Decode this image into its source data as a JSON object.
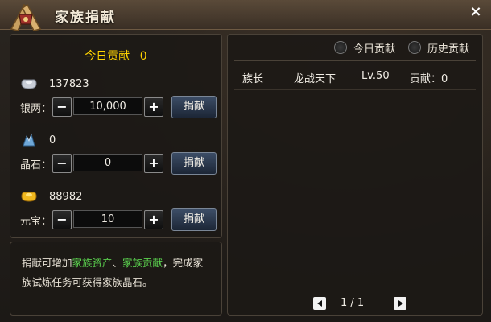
{
  "window": {
    "title": "家族捐献",
    "close_label": "×"
  },
  "donate": {
    "today_label": "今日贡献",
    "today_value": "0",
    "button_label": "捐献",
    "resources": [
      {
        "name": "银两",
        "amount": "137823",
        "quantity": "10,000",
        "icon": "silver-ingot-icon"
      },
      {
        "name": "晶石",
        "amount": "0",
        "quantity": "0",
        "icon": "crystal-icon"
      },
      {
        "name": "元宝",
        "amount": "88982",
        "quantity": "10",
        "icon": "gold-ingot-icon"
      }
    ],
    "minus_label": "−",
    "plus_label": "+"
  },
  "tip": {
    "part1": "捐献可增加",
    "highlight1": "家族资产",
    "sep": "、",
    "highlight2": "家族贡献",
    "part2": "，完成家族试炼任务可获得家族晶石。"
  },
  "ranking": {
    "tabs": [
      {
        "label": "今日贡献"
      },
      {
        "label": "历史贡献"
      }
    ],
    "rows": [
      {
        "role": "族长",
        "name": "龙战天下",
        "level": "Lv.50",
        "contribution": "贡献：0"
      }
    ],
    "pager": {
      "text": "1 / 1"
    }
  },
  "colors": {
    "today_highlight": "#ffd400",
    "tip_highlight": "#5ad04e"
  }
}
